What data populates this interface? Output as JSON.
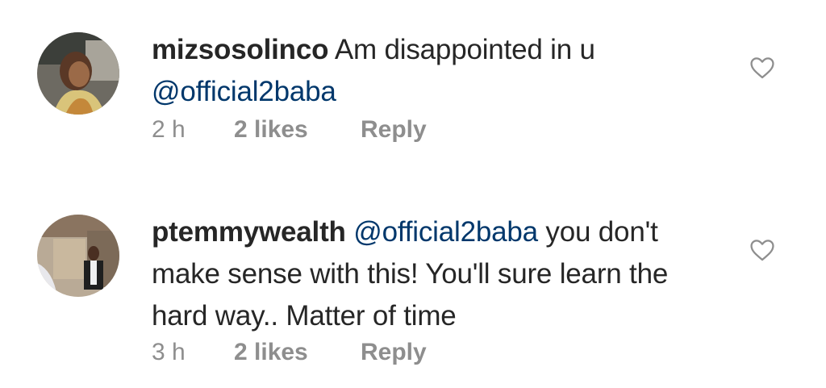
{
  "comments": [
    {
      "username": "mizsosolinco",
      "text_before": " Am disappointed in u ",
      "mention": "@official2baba",
      "text_after": "",
      "time": "2 h",
      "likes": "2 likes",
      "reply": "Reply",
      "avatar": "profile-photo-icon",
      "like_icon": "heart-outline-icon"
    },
    {
      "username": "ptemmywealth",
      "text_before": " ",
      "mention": "@official2baba",
      "text_after": " you don't make sense with this! You'll sure learn the hard way.. Matter of time",
      "time": "3 h",
      "likes": "2 likes",
      "reply": "Reply",
      "avatar": "profile-photo-icon",
      "like_icon": "heart-outline-icon"
    }
  ],
  "colors": {
    "text": "#262626",
    "mention": "#00376b",
    "meta": "#8e8e8e",
    "background": "#ffffff"
  }
}
